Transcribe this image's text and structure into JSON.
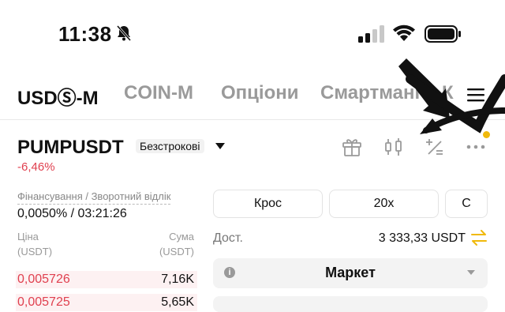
{
  "status_bar": {
    "time": "11:38"
  },
  "tabs": [
    {
      "label": "USDⓈ-M",
      "active": true
    },
    {
      "label": "COIN-M",
      "active": false
    },
    {
      "label": "Опціони",
      "active": false
    },
    {
      "label": "Смартмані",
      "active": false
    },
    {
      "label": "К",
      "active": false
    }
  ],
  "header": {
    "symbol": "PUMPUSDT",
    "contract_type": "Безстрокові",
    "change": "-6,46%"
  },
  "funding": {
    "label": "Фінансування / Зворотний відлік",
    "value": "0,0050% / 03:21:26"
  },
  "order_book": {
    "price_label": "Ціна\n(USDT)",
    "amount_label": "Сума\n(USDT)",
    "price_label_line1": "Ціна",
    "price_label_line2": "(USDT)",
    "amount_label_line1": "Сума",
    "amount_label_line2": "(USDT)",
    "asks": [
      {
        "price": "0,005726",
        "amount": "7,16K"
      },
      {
        "price": "0,005725",
        "amount": "5,65K"
      }
    ]
  },
  "trade_panel": {
    "margin_mode": "Крос",
    "leverage": "20x",
    "third_option": "С",
    "available_label": "Дост.",
    "available_value": "3 333,33 USDT",
    "order_type": "Маркет"
  },
  "colors": {
    "negative": "#e0404f",
    "accent": "#f0b90b"
  }
}
